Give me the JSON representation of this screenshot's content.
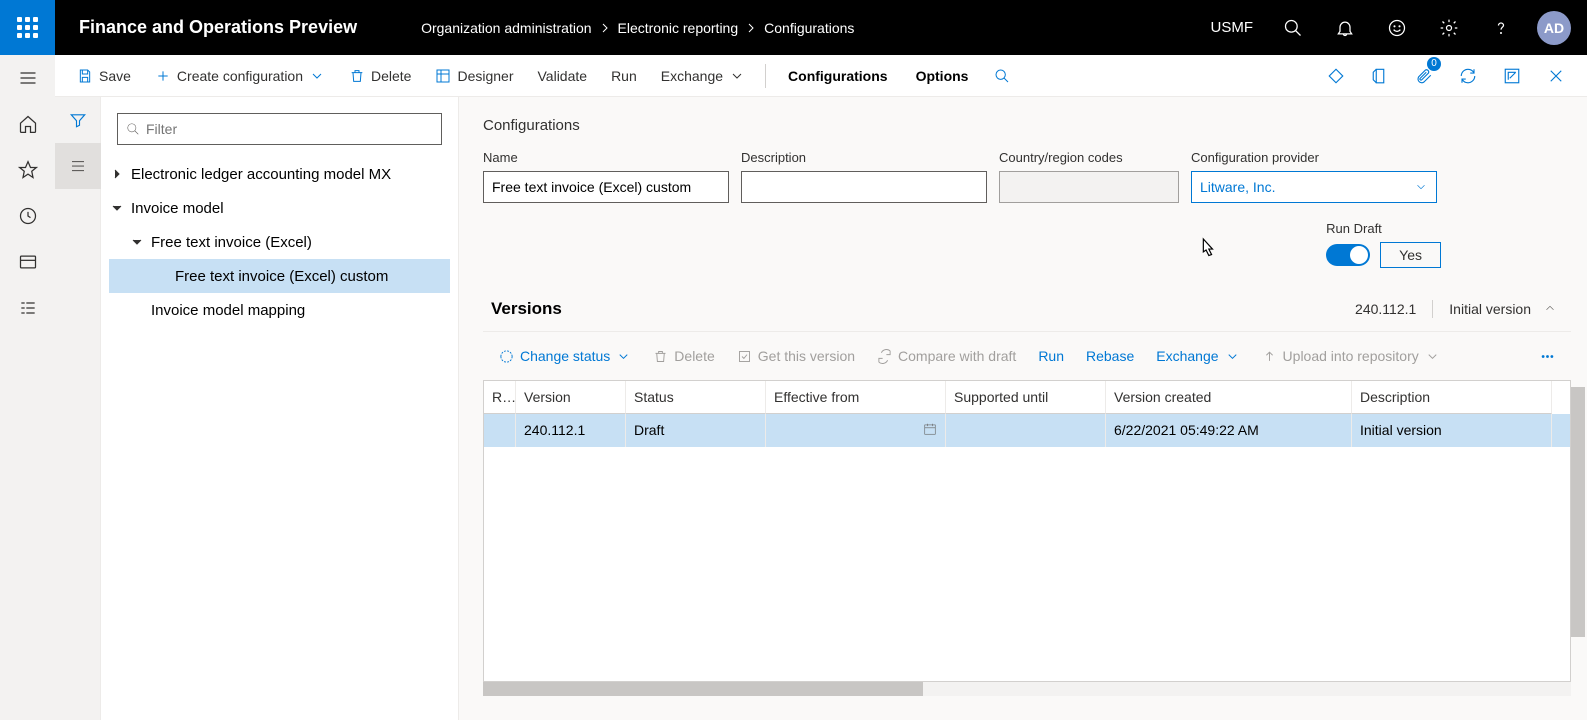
{
  "header": {
    "app_title": "Finance and Operations Preview",
    "breadcrumb": [
      "Organization administration",
      "Electronic reporting",
      "Configurations"
    ],
    "company": "USMF",
    "avatar": "AD"
  },
  "action_bar": {
    "save": "Save",
    "create": "Create configuration",
    "delete": "Delete",
    "designer": "Designer",
    "validate": "Validate",
    "run": "Run",
    "exchange": "Exchange",
    "configurations": "Configurations",
    "options": "Options",
    "attachment_count": "0"
  },
  "filter": {
    "placeholder": "Filter"
  },
  "tree": {
    "n0": "Electronic ledger accounting model MX",
    "n1": "Invoice model",
    "n2": "Free text invoice (Excel)",
    "n3": "Free text invoice (Excel) custom",
    "n4": "Invoice model mapping"
  },
  "form": {
    "section": "Configurations",
    "name_label": "Name",
    "name_value": "Free text invoice (Excel) custom",
    "desc_label": "Description",
    "desc_value": "",
    "country_label": "Country/region codes",
    "country_value": "",
    "provider_label": "Configuration provider",
    "provider_value": "Litware, Inc.",
    "rundraft_label": "Run Draft",
    "rundraft_value": "Yes"
  },
  "versions": {
    "title": "Versions",
    "meta_version": "240.112.1",
    "meta_desc": "Initial version",
    "toolbar": {
      "change_status": "Change status",
      "delete": "Delete",
      "get": "Get this version",
      "compare": "Compare with draft",
      "run": "Run",
      "rebase": "Rebase",
      "exchange": "Exchange",
      "upload": "Upload into repository"
    },
    "columns": {
      "r": "R...",
      "version": "Version",
      "status": "Status",
      "effective": "Effective from",
      "supported": "Supported until",
      "created": "Version created",
      "description": "Description"
    },
    "rows": [
      {
        "r": "",
        "version": "240.112.1",
        "status": "Draft",
        "effective": "",
        "supported": "",
        "created": "6/22/2021 05:49:22 AM",
        "description": "Initial version"
      }
    ]
  }
}
